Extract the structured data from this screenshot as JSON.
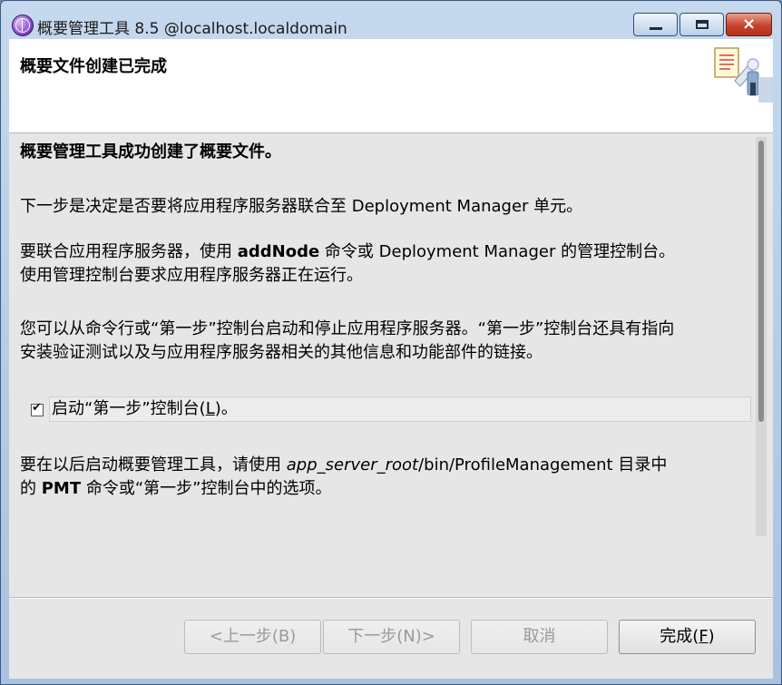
{
  "window": {
    "title": "概要管理工具 8.5 @localhost.localdomain",
    "buttons": {
      "minimize": "minimize",
      "maximize": "maximize",
      "close": "×"
    }
  },
  "banner": {
    "title": "概要文件创建已完成"
  },
  "content": {
    "heading": "概要管理工具成功创建了概要文件。",
    "para1": "下一步是决定是否要将应用程序服务器联合至 Deployment Manager 单元。",
    "para2_pre": " 要联合应用程序服务器，使用 ",
    "para2_cmd": "addNode",
    "para2_post": " 命令或 Deployment Manager 的管理控制台。",
    "para2_line2": "使用管理控制台要求应用程序服务器正在运行。",
    "para3_line1": "您可以从命令行或“第一步”控制台启动和停止应用程序服务器。“第一步”控制台还具有指向",
    "para3_line2": "安装验证测试以及与应用程序服务器相关的其他信息和功能部件的链接。",
    "checkbox": {
      "label_pre": "启动“第一步”控制台(",
      "mnemonic": "L",
      "label_post": ")。",
      "checked": true
    },
    "para4_pre": "要在以后启动概要管理工具，请使用 ",
    "para4_path_italic": "app_server_root",
    "para4_path_rest": "/bin/ProfileManagement 目录中",
    "para4_line2_pre": "的 ",
    "para4_line2_cmd": "PMT",
    "para4_line2_post": " 命令或“第一步”控制台中的选项。"
  },
  "buttons": {
    "back": "<上一步(B)",
    "next": "下一步(N)>",
    "cancel": "取消",
    "finish_pre": "完成(",
    "finish_mnemonic": "F",
    "finish_post": ")"
  },
  "icons": {
    "app": "globe-icon",
    "banner": "wizard-document-person-icon",
    "checkmark": "checkmark-icon"
  },
  "colors": {
    "titlebar": "#b3cbe6",
    "client_bg": "#e6e6e6",
    "close_button": "#c4432c"
  }
}
